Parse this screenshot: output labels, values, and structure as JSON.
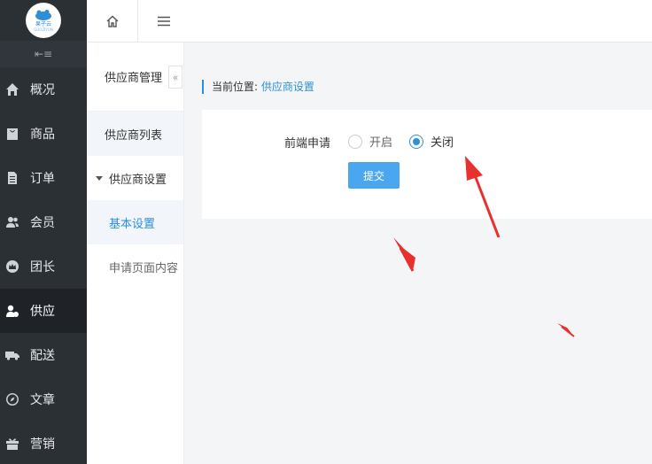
{
  "logo": {
    "text": "果子云",
    "sub": "GUOZIYUN"
  },
  "sidebar": {
    "collapse_icon": "collapse-menu-icon",
    "items": [
      {
        "label": "概况",
        "icon": "home-icon"
      },
      {
        "label": "商品",
        "icon": "bag-icon"
      },
      {
        "label": "订单",
        "icon": "document-icon"
      },
      {
        "label": "会员",
        "icon": "users-icon"
      },
      {
        "label": "团长",
        "icon": "crown-icon"
      },
      {
        "label": "供应",
        "icon": "supplier-icon",
        "active": true
      },
      {
        "label": "配送",
        "icon": "truck-icon"
      },
      {
        "label": "文章",
        "icon": "compass-icon"
      },
      {
        "label": "营销",
        "icon": "gift-icon"
      }
    ]
  },
  "topbar": {
    "home_icon": "home-icon",
    "menu_icon": "menu-icon"
  },
  "subnav": {
    "title": "供应商管理",
    "collapse": "«",
    "items": [
      {
        "label": "供应商列表"
      },
      {
        "label": "供应商设置",
        "group": true
      },
      {
        "label": "基本设置",
        "active": true
      },
      {
        "label": "申请页面内容"
      }
    ]
  },
  "breadcrumb": {
    "prefix": "当前位置:",
    "current": "供应商设置"
  },
  "form": {
    "label": "前端申请",
    "options": [
      {
        "label": "开启",
        "checked": false
      },
      {
        "label": "关闭",
        "checked": true
      }
    ],
    "submit_label": "提交"
  },
  "colors": {
    "accent": "#2e8fd8",
    "sidebar_bg": "#2b3035",
    "annotation": "#e8302c"
  }
}
